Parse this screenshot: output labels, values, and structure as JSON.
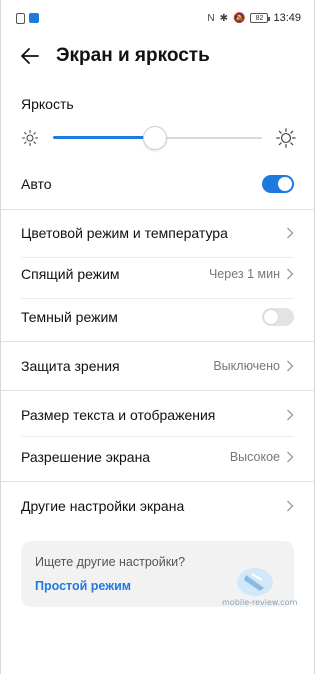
{
  "status_bar": {
    "time": "13:49",
    "battery": "82",
    "left_icons": [
      "sim-icon",
      "app-notification-icon"
    ],
    "right_icons": [
      "nfc-icon",
      "bluetooth-icon",
      "mute-icon",
      "battery-icon"
    ]
  },
  "header": {
    "title": "Экран и яркость"
  },
  "brightness": {
    "label": "Яркость",
    "level": 0.49
  },
  "auto": {
    "label": "Авто",
    "on": true
  },
  "rows": {
    "color_mode": {
      "label": "Цветовой режим и температура"
    },
    "sleep": {
      "label": "Спящий режим",
      "value": "Через 1 мин"
    },
    "dark": {
      "label": "Темный режим",
      "on": false
    },
    "eye_protection": {
      "label": "Защита зрения",
      "value": "Выключено"
    },
    "text_size": {
      "label": "Размер текста и отображения"
    },
    "resolution": {
      "label": "Разрешение экрана",
      "value": "Высокое"
    },
    "other": {
      "label": "Другие настройки экрана"
    }
  },
  "suggestion": {
    "question": "Ищете другие настройки?",
    "link": "Простой режим"
  },
  "watermark": "mobile-review.com",
  "colors": {
    "accent": "#1f7ae0",
    "text": "#111111",
    "secondary": "#777777"
  }
}
